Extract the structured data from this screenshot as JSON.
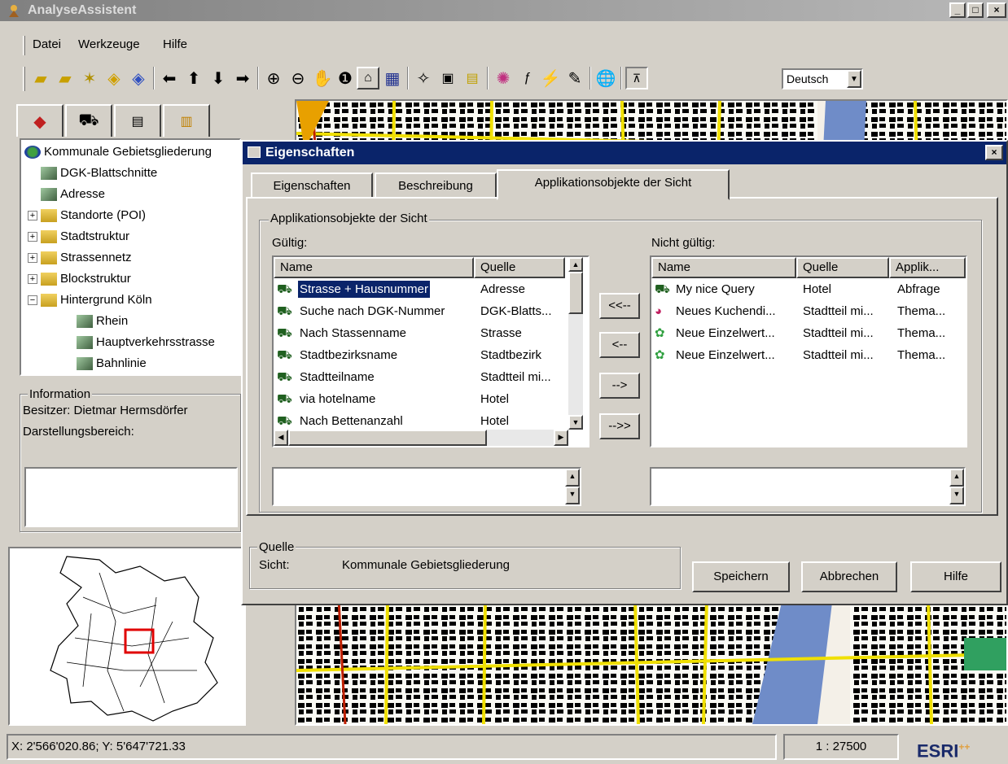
{
  "window": {
    "title": "AnalyseAssistent",
    "min": "_",
    "max": "□",
    "close": "×"
  },
  "menu": [
    "Datei",
    "Werkzeuge",
    "Hilfe"
  ],
  "toolbar": {
    "language": "Deutsch"
  },
  "icons": {
    "app": "globe-person-icon",
    "tools": [
      "add-layer-icon",
      "add-layer2-icon",
      "layer-wizard-icon",
      "diamond-select-icon",
      "back-nav-icon",
      "arrow-left-icon",
      "arrow-up-icon",
      "arrow-down-icon",
      "arrow-right-icon",
      "zoom-in-icon",
      "zoom-out-icon",
      "pan-hand-icon",
      "info-icon",
      "measure-icon",
      "select-features-icon",
      "new-item-icon",
      "table-icon",
      "form-icon",
      "thematic-map-icon",
      "query-icon",
      "hotlink-icon",
      "edit-icon",
      "globe-icon",
      "scale-icon"
    ]
  },
  "left_tabs": [
    "layers-tab-icon",
    "binoculars-tab-icon",
    "list-tab-icon",
    "chart-tab-icon"
  ],
  "tree": {
    "root": "Kommunale Gebietsgliederung",
    "items": [
      {
        "label": "DGK-Blattschnitte",
        "expander": ""
      },
      {
        "label": "Adresse",
        "expander": ""
      },
      {
        "label": "Standorte (POI)",
        "expander": "+"
      },
      {
        "label": "Stadtstruktur",
        "expander": "+"
      },
      {
        "label": "Strassennetz",
        "expander": "+"
      },
      {
        "label": "Blockstruktur",
        "expander": "+"
      },
      {
        "label": "Hintergrund Köln",
        "expander": "−"
      },
      {
        "label": "Rhein",
        "expander": ""
      },
      {
        "label": "Hauptverkehrsstrasse",
        "expander": ""
      },
      {
        "label": "Bahnlinie",
        "expander": ""
      }
    ]
  },
  "info": {
    "legend": "Information",
    "owner": "Besitzer: Dietmar Hermsdörfer",
    "range": "Darstellungsbereich:"
  },
  "dialog": {
    "title": "Eigenschaften",
    "close": "×",
    "tabs": [
      "Eigenschaften",
      "Beschreibung",
      "Applikationsobjekte der Sicht"
    ],
    "group_label": "Applikationsobjekte der Sicht",
    "valid_label": "Gültig:",
    "invalid_label": "Nicht gültig:",
    "valid_headers": [
      "Name",
      "Quelle"
    ],
    "invalid_headers": [
      "Name",
      "Quelle",
      "Applik..."
    ],
    "valid_rows": [
      {
        "name": "Strasse + Hausnummer",
        "source": "Adresse"
      },
      {
        "name": "Suche nach DGK-Nummer",
        "source": "DGK-Blatts..."
      },
      {
        "name": "Nach Stassenname",
        "source": "Strasse"
      },
      {
        "name": "Stadtbezirksname",
        "source": "Stadtbezirk"
      },
      {
        "name": "Stadtteilname",
        "source": "Stadtteil mi..."
      },
      {
        "name": "via hotelname",
        "source": "Hotel"
      },
      {
        "name": "Nach Bettenanzahl",
        "source": "Hotel"
      }
    ],
    "invalid_rows": [
      {
        "name": "My nice Query",
        "source": "Hotel",
        "app": "Abfrage",
        "icon": "binoculars-icon"
      },
      {
        "name": "Neues Kuchendi...",
        "source": "Stadtteil mi...",
        "app": "Thema...",
        "icon": "pie-chart-icon"
      },
      {
        "name": "Neue Einzelwert...",
        "source": "Stadtteil mi...",
        "app": "Thema...",
        "icon": "map-theme-icon"
      },
      {
        "name": "Neue Einzelwert...",
        "source": "Stadtteil mi...",
        "app": "Thema...",
        "icon": "map-theme-icon"
      }
    ],
    "move_buttons": [
      "<<--",
      "<--",
      "-->",
      "-->>"
    ],
    "source_legend": "Quelle",
    "view_label": "Sicht:",
    "view_value": "Kommunale Gebietsgliederung",
    "buttons": {
      "save": "Speichern",
      "cancel": "Abbrechen",
      "help": "Hilfe"
    }
  },
  "status": {
    "coords": "X: 2'566'020.86; Y: 5'647'721.33",
    "scale": "1 : 27500",
    "logo": "ESRI",
    "logo_sup": "++"
  }
}
